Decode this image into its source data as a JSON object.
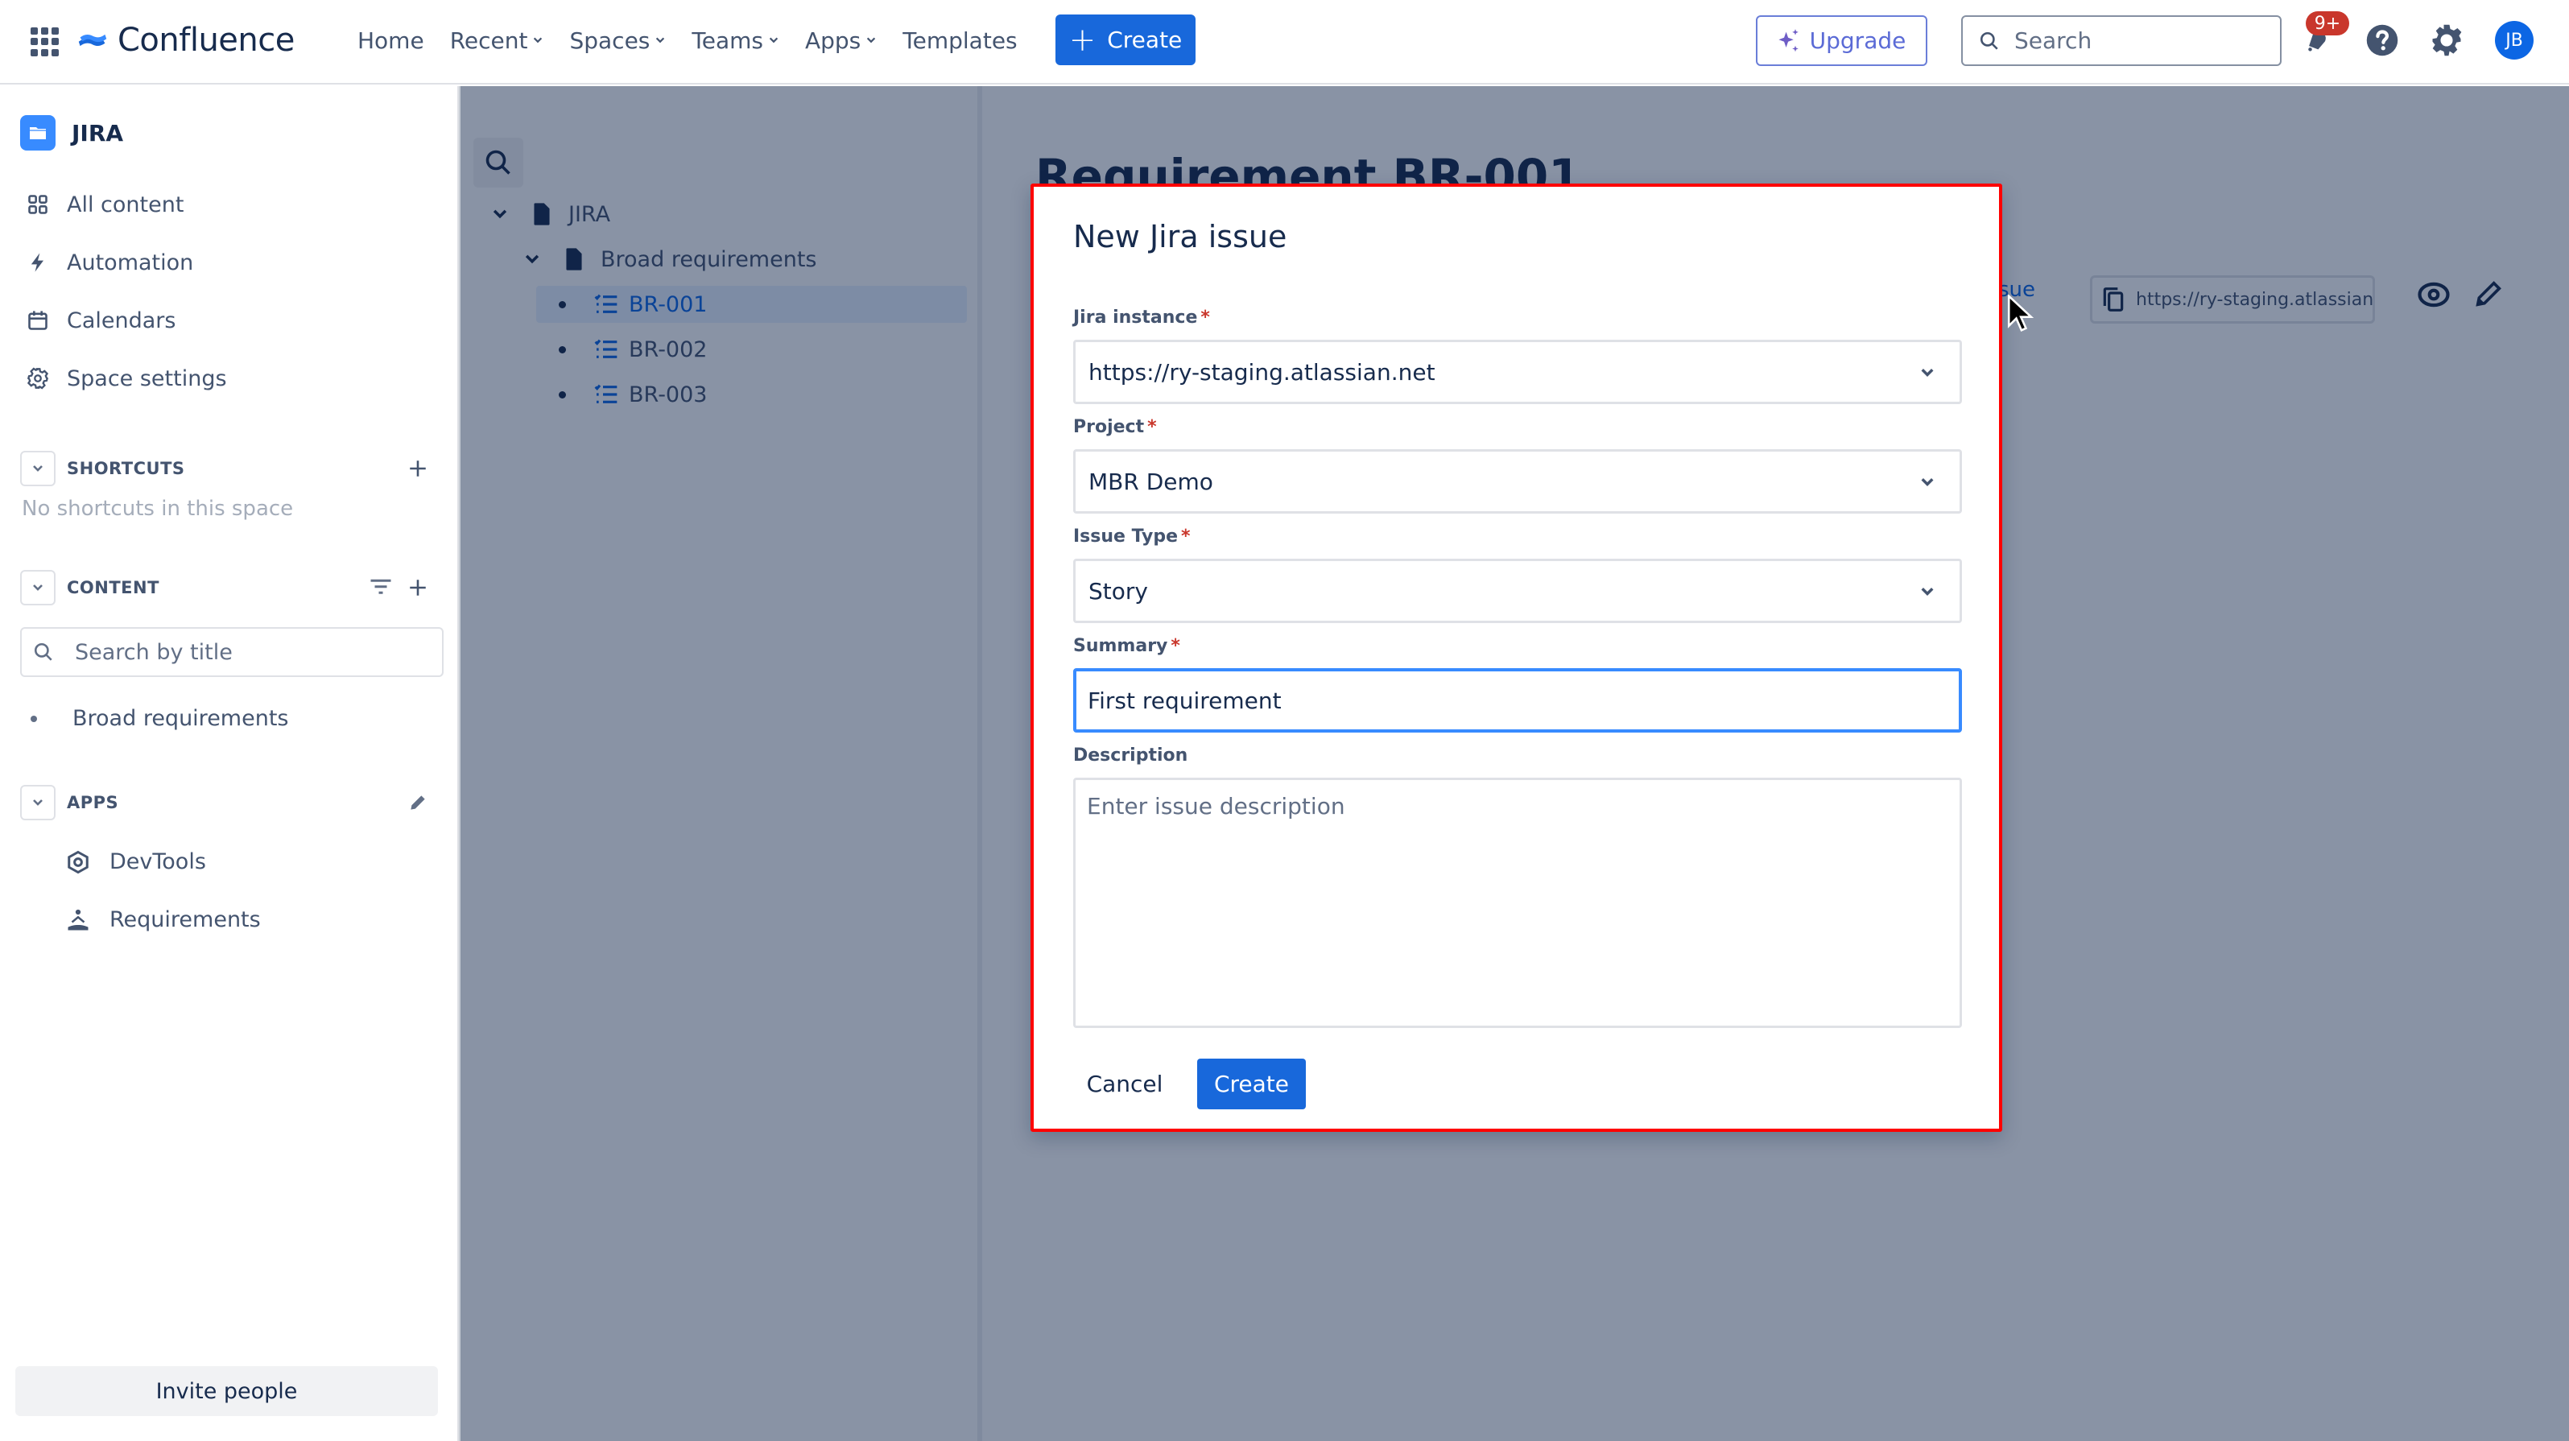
{
  "header": {
    "app_name": "Confluence",
    "nav": [
      {
        "label": "Home",
        "has_dropdown": false
      },
      {
        "label": "Recent",
        "has_dropdown": true
      },
      {
        "label": "Spaces",
        "has_dropdown": true
      },
      {
        "label": "Teams",
        "has_dropdown": true
      },
      {
        "label": "Apps",
        "has_dropdown": true
      },
      {
        "label": "Templates",
        "has_dropdown": false
      }
    ],
    "create_label": "Create",
    "upgrade_label": "Upgrade",
    "search_placeholder": "Search",
    "notifications_badge": "9+",
    "avatar_initials": "JB",
    "icons": {
      "app_switcher": "grid-icon",
      "notifications": "bell-icon",
      "help": "help-icon",
      "settings": "gear-icon"
    },
    "colors": {
      "primary": "#1868db",
      "badge": "#c9372c",
      "avatar": "#0c66e4"
    }
  },
  "sidebar": {
    "space_name": "JIRA",
    "items": [
      {
        "label": "All content",
        "icon": "grid-icon"
      },
      {
        "label": "Automation",
        "icon": "lightning-icon"
      },
      {
        "label": "Calendars",
        "icon": "calendar-icon"
      },
      {
        "label": "Space settings",
        "icon": "gear-icon"
      }
    ],
    "shortcuts": {
      "title": "SHORTCUTS",
      "empty_text": "No shortcuts in this space"
    },
    "content": {
      "title": "CONTENT",
      "search_placeholder": "Search by title",
      "items": [
        {
          "label": "Broad requirements"
        }
      ]
    },
    "apps": {
      "title": "APPS",
      "items": [
        {
          "label": "DevTools",
          "icon": "devtools-icon"
        },
        {
          "label": "Requirements",
          "icon": "requirements-icon"
        }
      ]
    },
    "invite_label": "Invite people"
  },
  "page_tree": {
    "root": "JIRA",
    "parent": "Broad requirements",
    "children": [
      {
        "label": "BR-001",
        "selected": true
      },
      {
        "label": "BR-002",
        "selected": false
      },
      {
        "label": "BR-003",
        "selected": false
      }
    ]
  },
  "page": {
    "title": "Requirement BR-001",
    "issue_link_fragment": "sue",
    "url_pill": "https://ry-staging.atlassian.ne"
  },
  "dialog": {
    "title": "New Jira issue",
    "fields": {
      "jira_instance": {
        "label": "Jira instance",
        "required": true,
        "value": "https://ry-staging.atlassian.net"
      },
      "project": {
        "label": "Project",
        "required": true,
        "value": "MBR Demo"
      },
      "issue_type": {
        "label": "Issue Type",
        "required": true,
        "value": "Story"
      },
      "summary": {
        "label": "Summary",
        "required": true,
        "value": "First requirement"
      },
      "description": {
        "label": "Description",
        "required": false,
        "value": "",
        "placeholder": "Enter issue description"
      }
    },
    "required_marker": "*",
    "cancel_label": "Cancel",
    "submit_label": "Create"
  }
}
